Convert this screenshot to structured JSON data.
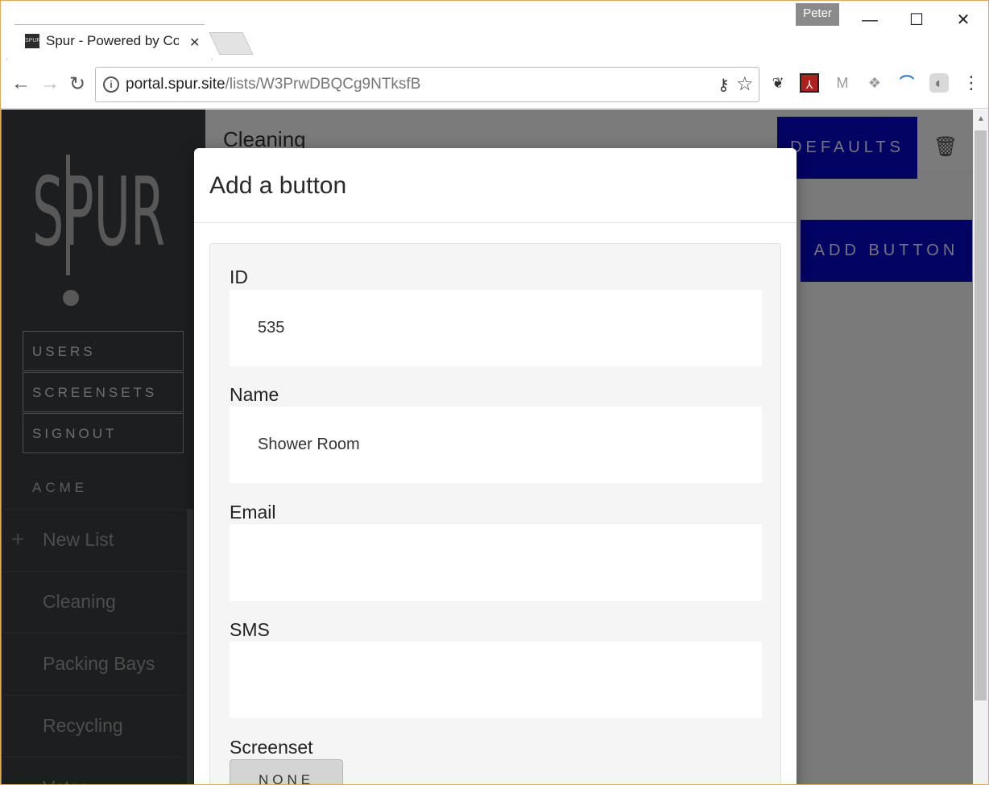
{
  "browser": {
    "tab_title": "Spur - Powered by Conti",
    "favicon_text": "SPUR",
    "profile": "Peter",
    "url_host": "portal.spur.site",
    "url_path": "/lists/W3PrwDBQCg9NTksfB"
  },
  "sidebar": {
    "logo": "SPUR",
    "nav_buttons": [
      "USERS",
      "SCREENSETS",
      "SIGNOUT"
    ],
    "org": "ACME",
    "lists": [
      "New List",
      "Cleaning",
      "Packing Bays",
      "Recycling",
      "Votes"
    ]
  },
  "main": {
    "title": "Cleaning",
    "defaults_label": "DEFAULTS",
    "add_button_label": "ADD BUTTON"
  },
  "modal": {
    "title": "Add a button",
    "fields": [
      {
        "label": "ID",
        "value": "535"
      },
      {
        "label": "Name",
        "value": "Shower Room"
      },
      {
        "label": "Email",
        "value": ""
      },
      {
        "label": "SMS",
        "value": ""
      }
    ],
    "screenset_label": "Screenset",
    "screenset_value": "NONE"
  },
  "colors": {
    "sidebar_bg": "#3a3c3e",
    "primary_button": "#0707c8",
    "overlay": "rgba(0,0,0,0.5)"
  }
}
